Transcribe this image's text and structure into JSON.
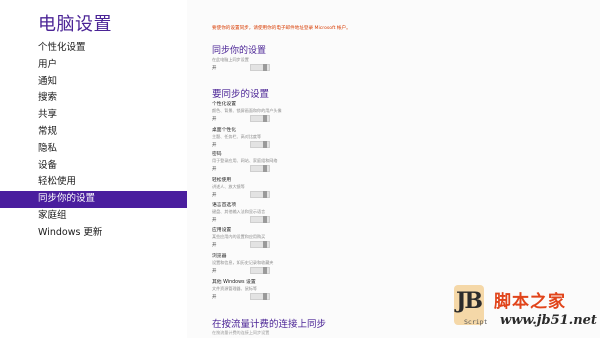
{
  "sidebar": {
    "title": "电脑设置",
    "items": [
      {
        "label": "个性化设置"
      },
      {
        "label": "用户"
      },
      {
        "label": "通知"
      },
      {
        "label": "搜索"
      },
      {
        "label": "共享"
      },
      {
        "label": "常规"
      },
      {
        "label": "隐私"
      },
      {
        "label": "设备"
      },
      {
        "label": "轻松使用"
      },
      {
        "label": "同步你的设置",
        "active": true
      },
      {
        "label": "家庭组"
      },
      {
        "label": "Windows 更新"
      }
    ]
  },
  "main": {
    "warning": "要使你的设置同步，请使用你的电子邮件地址登录 Microsoft 帐户。",
    "sync_section": {
      "heading": "同步你的设置",
      "desc": "在此电脑上同步设置",
      "state": "开"
    },
    "what_heading": "要同步的设置",
    "settings": [
      {
        "title": "个性化设置",
        "desc": "颜色、背景、锁屏画面和你的用户头像",
        "state": "开"
      },
      {
        "title": "桌面个性化",
        "desc": "主题、任务栏、高对比度等",
        "state": "开"
      },
      {
        "title": "密码",
        "desc": "用于登录应用、网站、家庭组和网络",
        "state": "开"
      },
      {
        "title": "轻松使用",
        "desc": "讲述人、放大镜等",
        "state": "开"
      },
      {
        "title": "语言首选项",
        "desc": "键盘、其他输入法和显示语言",
        "state": "开"
      },
      {
        "title": "应用设置",
        "desc": "某些应用内的设置和应用购买",
        "state": "开"
      },
      {
        "title": "浏览器",
        "desc": "设置和信息，如历史记录和收藏夹",
        "state": "开"
      },
      {
        "title": "其他 Windows 设置",
        "desc": "文件资源管理器、鼠标等",
        "state": "开"
      }
    ],
    "metered_heading": "在按流量计费的连接上同步",
    "metered_desc": "在按流量计费的连接上同步设置"
  },
  "watermark": {
    "logo_text": "JB",
    "logo_sub": "Script",
    "site_name": "脚本之家",
    "url": "www.jb51.net"
  },
  "colors": {
    "accent": "#4a1e9e",
    "heading": "#4b2496",
    "warning": "#d83b01"
  }
}
